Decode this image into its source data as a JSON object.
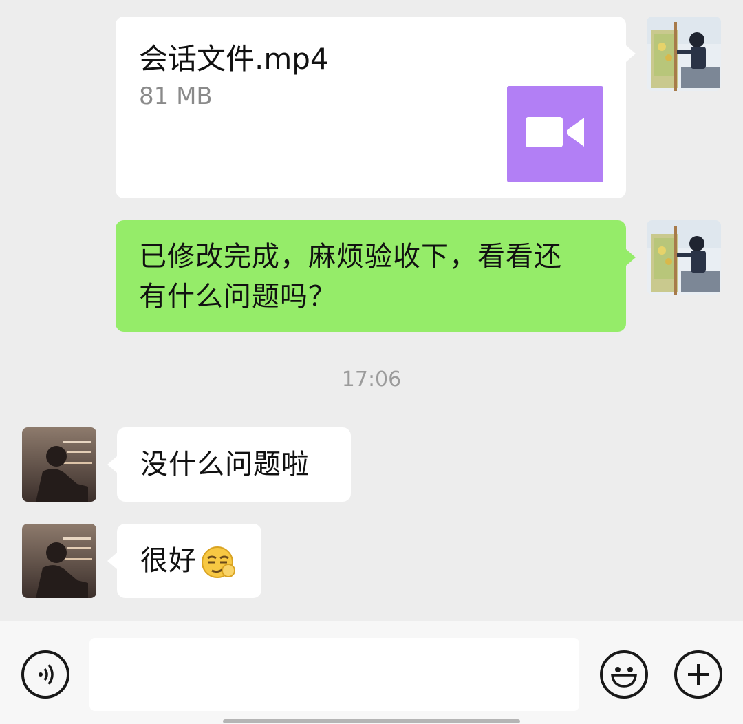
{
  "messages": {
    "file": {
      "name": "会话文件.mp4",
      "size": "81 MB",
      "thumb_icon": "video-camera-icon",
      "thumb_color": "#b27ff5"
    },
    "sent_text": {
      "line1": "已修改完成，麻烦验收下，看看还",
      "line2": "有什么问题吗？"
    },
    "timestamp": "17:06",
    "received_1": "没什么问题啦",
    "received_2": {
      "text": "很好",
      "emoji": "smirk-face-emoji"
    }
  },
  "input_bar": {
    "voice_icon": "voice-icon",
    "emoji_icon": "emoji-icon",
    "plus_icon": "plus-icon",
    "input_value": ""
  },
  "colors": {
    "background": "#ededed",
    "sent_bubble": "#95ec69",
    "received_bubble": "#ffffff",
    "video_thumb": "#b27ff5"
  }
}
